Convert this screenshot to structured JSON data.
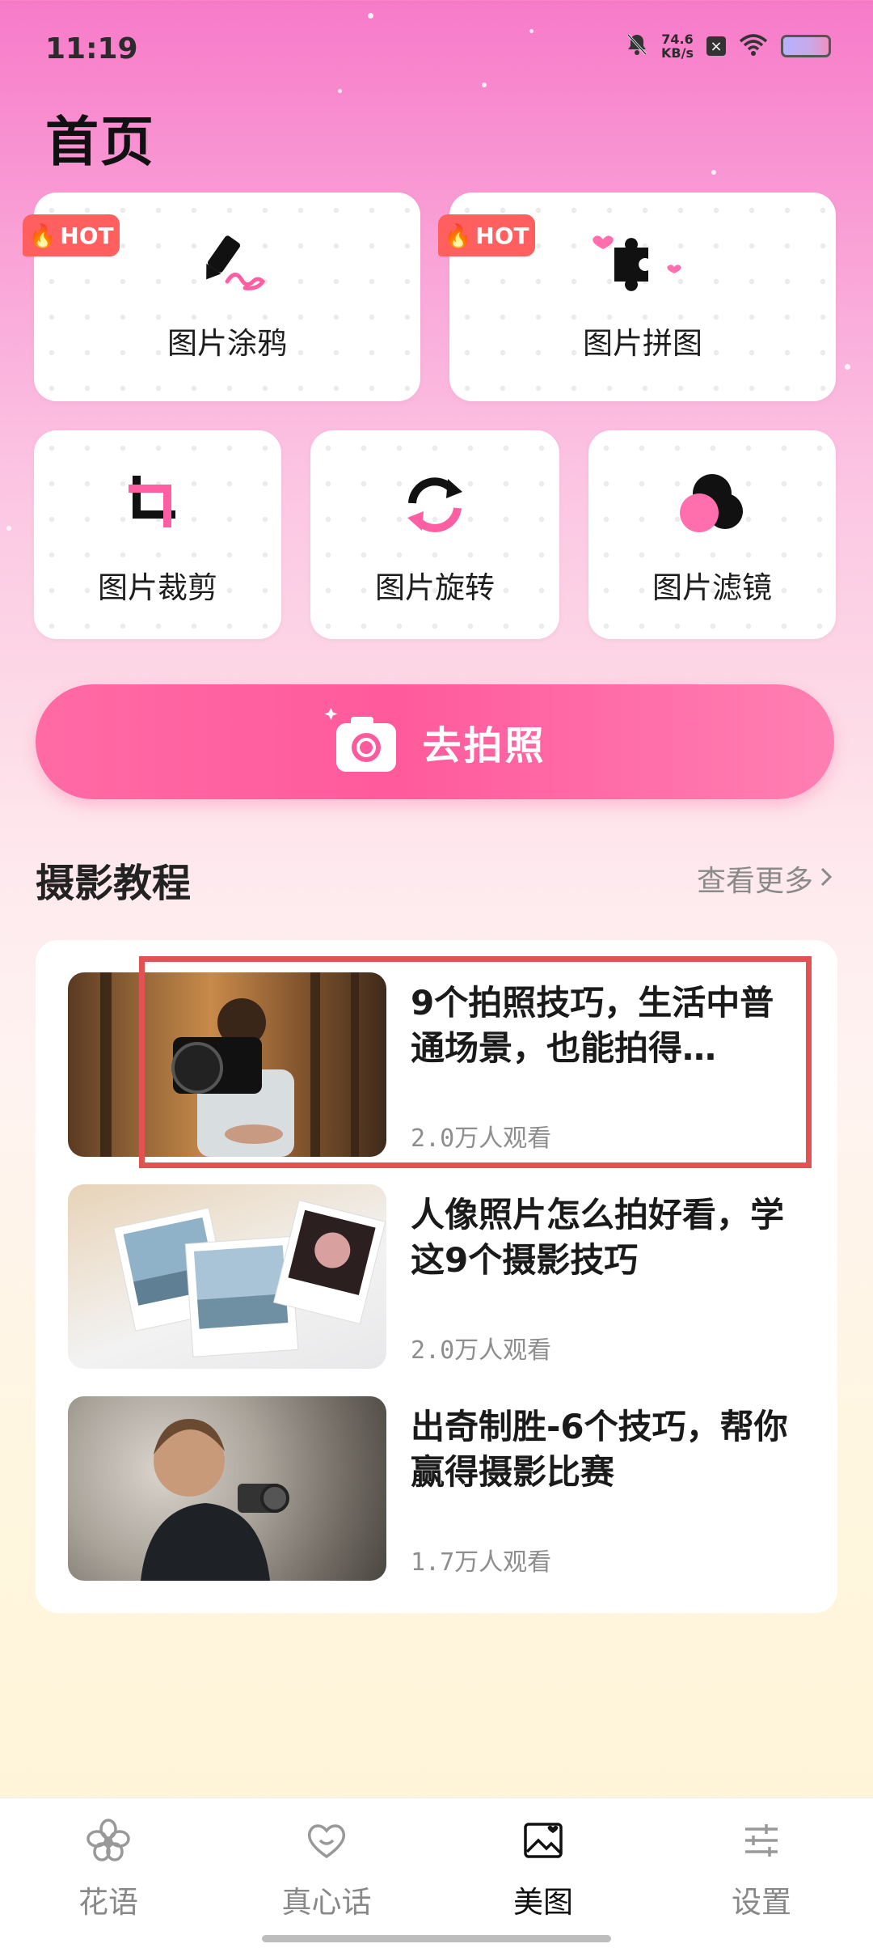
{
  "status_bar": {
    "time": "11:19",
    "net_speed_value": "74.6",
    "net_speed_unit": "KB/s",
    "icons": [
      "mute-icon",
      "net-speed",
      "close-box-icon",
      "wifi-icon",
      "battery-icon"
    ]
  },
  "page": {
    "title": "首页"
  },
  "tools": [
    {
      "label": "图片涂鸦",
      "badge": "HOT",
      "icon": "graffiti-pen-icon"
    },
    {
      "label": "图片拼图",
      "badge": "HOT",
      "icon": "puzzle-icon"
    },
    {
      "label": "图片裁剪",
      "icon": "crop-icon"
    },
    {
      "label": "图片旋转",
      "icon": "rotate-icon"
    },
    {
      "label": "图片滤镜",
      "icon": "filter-icon"
    }
  ],
  "shoot_button": {
    "label": "去拍照",
    "icon": "camera-icon"
  },
  "tutorials": {
    "title": "摄影教程",
    "see_more": "查看更多",
    "items": [
      {
        "title": "9个拍照技巧，生活中普通场景，也能拍得…",
        "views": "2.0万人观看",
        "highlighted": true
      },
      {
        "title": "人像照片怎么拍好看，学这9个摄影技巧",
        "views": "2.0万人观看"
      },
      {
        "title": "出奇制胜-6个技巧，帮你赢得摄影比赛",
        "views": "1.7万人观看"
      }
    ]
  },
  "tabbar": {
    "tabs": [
      {
        "label": "花语",
        "icon": "flower-icon"
      },
      {
        "label": "真心话",
        "icon": "heart-icon"
      },
      {
        "label": "美图",
        "icon": "picture-icon",
        "active": true
      },
      {
        "label": "设置",
        "icon": "settings-sliders-icon"
      }
    ]
  },
  "colors": {
    "accent_pink": "#ff5a9c",
    "hot_badge": "#ff5f5f",
    "highlight_box": "#e35252"
  }
}
